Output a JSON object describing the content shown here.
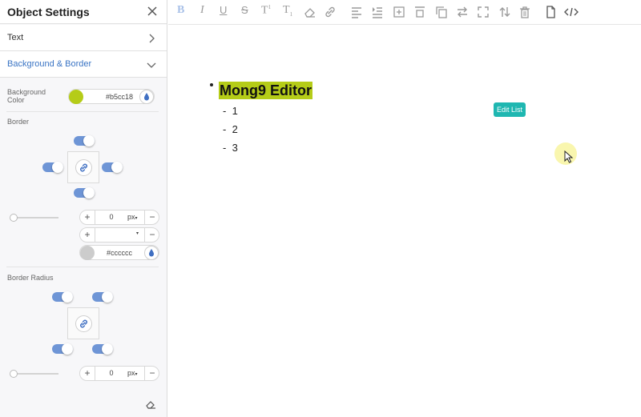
{
  "panel": {
    "title": "Object Settings",
    "sections": {
      "text": "Text",
      "background_border": "Background & Border"
    },
    "background_color": {
      "label": "Background Color",
      "value": "#b5cc18",
      "swatch": "#b5cc18"
    },
    "border": {
      "label": "Border",
      "width_value": "0",
      "width_unit": "px",
      "style_value": "",
      "color_value": "#cccccc",
      "swatch": "#cccccc"
    },
    "border_radius": {
      "label": "Border Radius",
      "value": "0",
      "unit": "px"
    },
    "stepper": {
      "plus": "+",
      "minus": "−",
      "caret": "▾"
    }
  },
  "toolbar": {
    "items": [
      "bold-icon",
      "italic-icon",
      "underline-icon",
      "strikethrough-icon",
      "superscript-icon",
      "subscript-icon",
      "eraser-icon",
      "link-icon",
      "align-icon",
      "indent-icon",
      "add-block-icon",
      "insert-above-icon",
      "copy-icon",
      "swap-icon",
      "expand-icon",
      "sort-icon",
      "trash-icon",
      "page-icon",
      "code-icon"
    ],
    "active_color": "#a9c1e8",
    "icon_color": "#9a9a9a"
  },
  "document": {
    "heading": "Mong9 Editor",
    "heading_highlight": "#b5cc18",
    "items": [
      {
        "marker": "-",
        "text": "1"
      },
      {
        "marker": "-",
        "text": "2"
      },
      {
        "marker": "-",
        "text": "3"
      }
    ],
    "edit_list_button": "Edit List",
    "edit_list_color": "#1fb7b1"
  }
}
